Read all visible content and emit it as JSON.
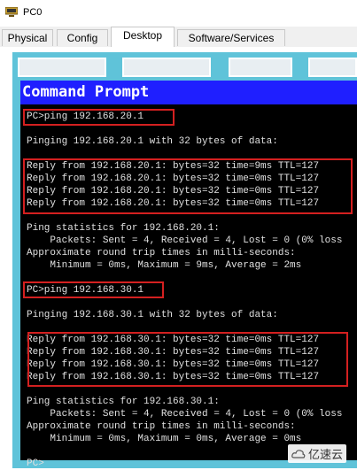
{
  "window": {
    "title": "PC0",
    "app_icon": "pc-icon"
  },
  "tabs": [
    {
      "label": "Physical",
      "active": false
    },
    {
      "label": "Config",
      "active": false
    },
    {
      "label": "Desktop",
      "active": true
    },
    {
      "label": "Software/Services",
      "active": false
    }
  ],
  "command_prompt": {
    "title": "Command Prompt",
    "lines": [
      "PC>ping 192.168.20.1",
      "Pinging 192.168.20.1 with 32 bytes of data:",
      "Reply from 192.168.20.1: bytes=32 time=9ms TTL=127",
      "Reply from 192.168.20.1: bytes=32 time=0ms TTL=127",
      "Reply from 192.168.20.1: bytes=32 time=0ms TTL=127",
      "Reply from 192.168.20.1: bytes=32 time=0ms TTL=127",
      "Ping statistics for 192.168.20.1:",
      "    Packets: Sent = 4, Received = 4, Lost = 0 (0% loss",
      "Approximate round trip times in milli-seconds:",
      "    Minimum = 0ms, Maximum = 9ms, Average = 2ms",
      "PC>ping 192.168.30.1",
      "Pinging 192.168.30.1 with 32 bytes of data:",
      "Reply from 192.168.30.1: bytes=32 time=0ms TTL=127",
      "Reply from 192.168.30.1: bytes=32 time=0ms TTL=127",
      "Reply from 192.168.30.1: bytes=32 time=0ms TTL=127",
      "Reply from 192.168.30.1: bytes=32 time=0ms TTL=127",
      "Ping statistics for 192.168.30.1:",
      "    Packets: Sent = 4, Received = 4, Lost = 0 (0% loss",
      "Approximate round trip times in milli-seconds:",
      "    Minimum = 0ms, Maximum = 0ms, Average = 0ms",
      "PC>"
    ]
  },
  "watermark": {
    "text": "亿速云"
  },
  "colors": {
    "desktop_bg": "#5fc3d9",
    "cmd_header": "#1f1fff",
    "cmd_bg": "#000000",
    "highlight": "#d42020"
  }
}
